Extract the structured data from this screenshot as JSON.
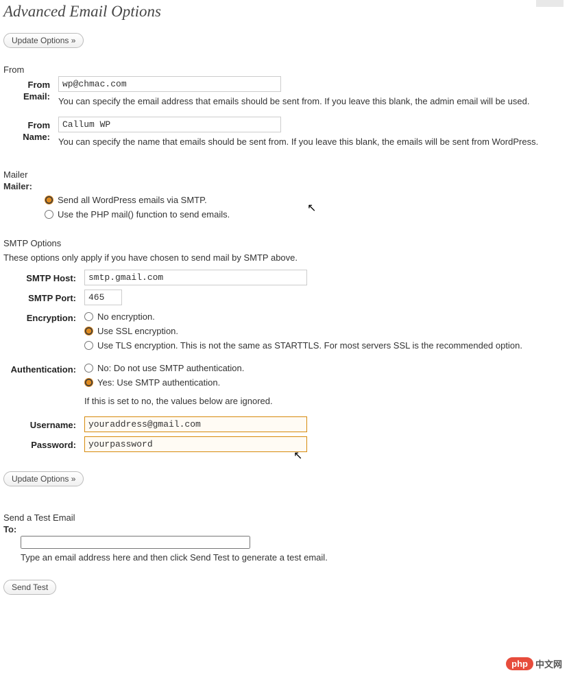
{
  "page": {
    "title": "Advanced Email Options",
    "update_button": "Update Options »",
    "send_test_button": "Send Test"
  },
  "from": {
    "heading": "From",
    "email_label": "From Email:",
    "email_value": "wp@chmac.com",
    "email_help": "You can specify the email address that emails should be sent from. If you leave this blank, the admin email will be used.",
    "name_label": "From Name:",
    "name_value": "Callum WP",
    "name_help": "You can specify the name that emails should be sent from. If you leave this blank, the emails will be sent from WordPress."
  },
  "mailer": {
    "heading": "Mailer",
    "label": "Mailer:",
    "option_smtp": "Send all WordPress emails via SMTP.",
    "option_php": "Use the PHP mail() function to send emails."
  },
  "smtp": {
    "heading": "SMTP Options",
    "description": "These options only apply if you have chosen to send mail by SMTP above.",
    "host_label": "SMTP Host:",
    "host_value": "smtp.gmail.com",
    "port_label": "SMTP Port:",
    "port_value": "465",
    "encryption_label": "Encryption:",
    "enc_none": "No encryption.",
    "enc_ssl": "Use SSL encryption.",
    "enc_tls": "Use TLS encryption. This is not the same as STARTTLS. For most servers SSL is the recommended option.",
    "auth_label": "Authentication:",
    "auth_no": "No: Do not use SMTP authentication.",
    "auth_yes": "Yes: Use SMTP authentication.",
    "auth_help": "If this is set to no, the values below are ignored.",
    "username_label": "Username:",
    "username_value": "youraddress@gmail.com",
    "password_label": "Password:",
    "password_value": "yourpassword"
  },
  "test": {
    "heading": "Send a Test Email",
    "to_label": "To:",
    "to_value": "",
    "help": "Type an email address here and then click Send Test to generate a test email."
  },
  "watermark": {
    "pill": "php",
    "text": "中文网"
  }
}
